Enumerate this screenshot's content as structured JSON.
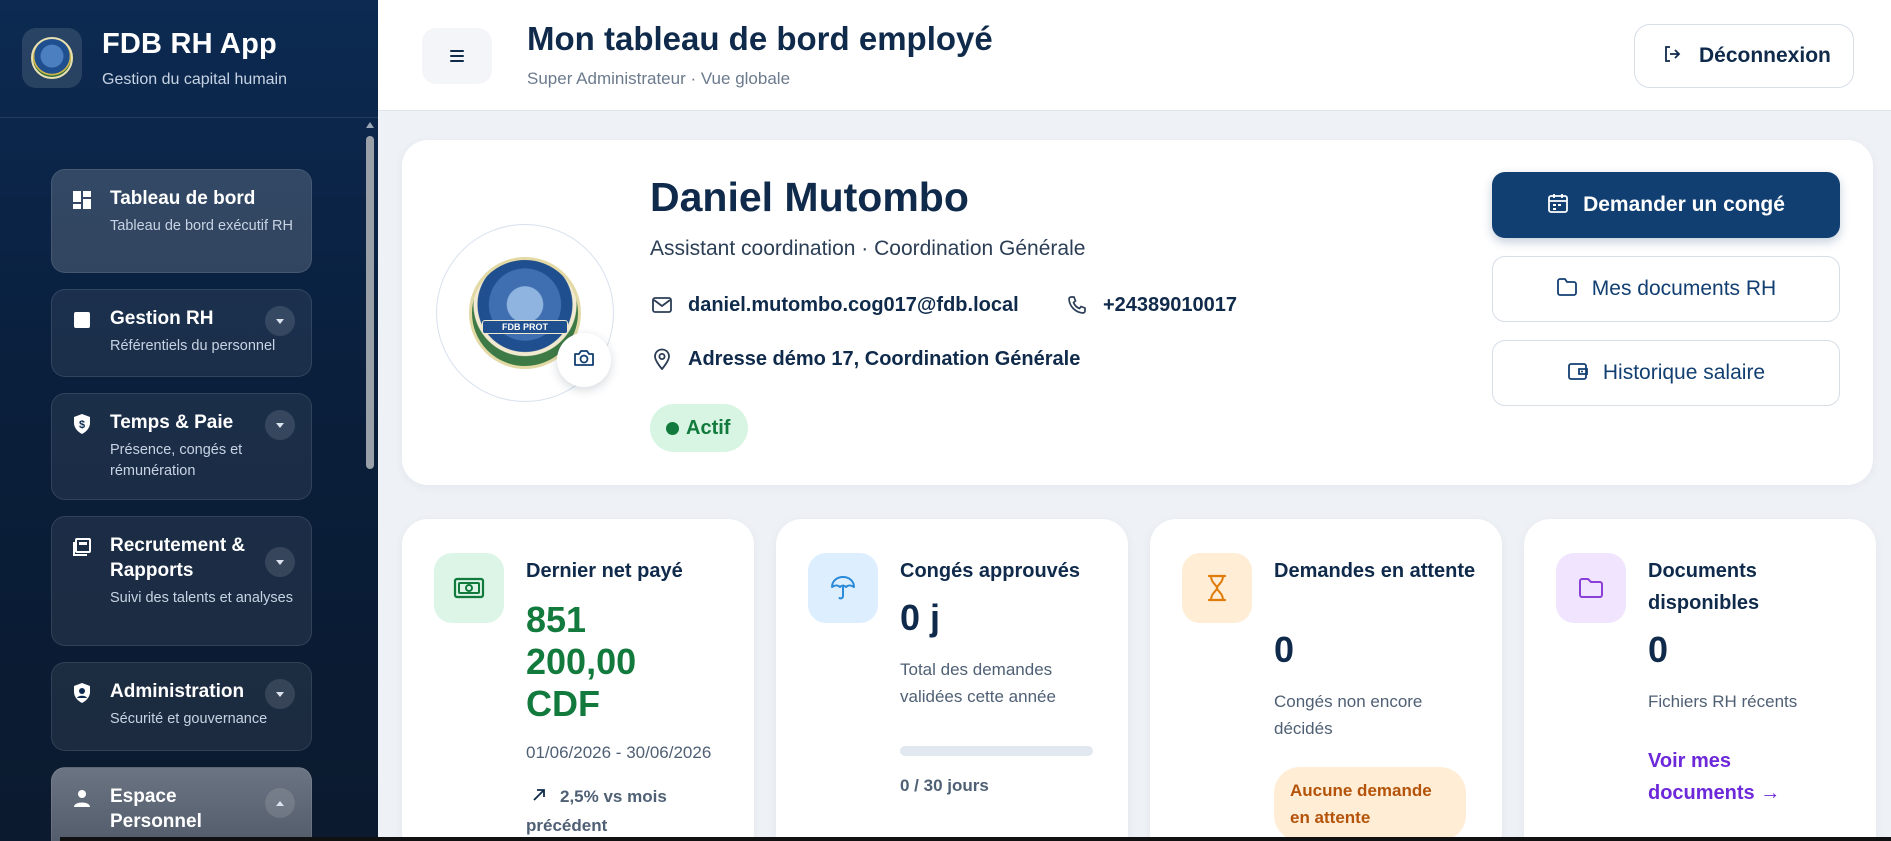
{
  "brand": {
    "title": "FDB RH App",
    "subtitle": "Gestion du capital humain"
  },
  "sidebar": {
    "items": [
      {
        "title": "Tableau de bord",
        "desc": "Tableau de bord exécutif RH"
      },
      {
        "title": "Gestion RH",
        "desc": "Référentiels du personnel"
      },
      {
        "title": "Temps & Paie",
        "desc": "Présence, congés et rémunération"
      },
      {
        "title": "Recrutement & Rapports",
        "desc": "Suivi des talents et analyses"
      },
      {
        "title": "Administration",
        "desc": "Sécurité et gouvernance"
      },
      {
        "title": "Espace Personnel",
        "desc": ""
      }
    ]
  },
  "header": {
    "title": "Mon tableau de bord employé",
    "subtitle": "Super Administrateur · Vue globale",
    "logout_label": "Déconnexion"
  },
  "profile": {
    "avatar_text": "FDB PROT",
    "name": "Daniel Mutombo",
    "role": "Assistant coordination · Coordination Générale",
    "email": "daniel.mutombo.cog017@fdb.local",
    "phone": "+24389010017",
    "address": "Adresse démo 17, Coordination Générale",
    "status": "Actif",
    "actions": {
      "leave": "Demander un congé",
      "documents": "Mes documents RH",
      "salary": "Historique salaire"
    }
  },
  "stats": {
    "pay": {
      "title": "Dernier net payé",
      "value": "851 200,00 CDF",
      "period": "01/06/2026 - 30/06/2026",
      "trend": "2,5% vs mois précédent"
    },
    "leave": {
      "title": "Congés approuvés",
      "value": "0 j",
      "desc": "Total des demandes validées cette année",
      "progress_fraction": 0,
      "progress_label": "0 / 30 jours"
    },
    "pending": {
      "title": "Demandes en attente",
      "value": "0",
      "desc": "Congés non encore décidés",
      "pill": "Aucune demande en attente"
    },
    "docs": {
      "title": "Documents disponibles",
      "value": "0",
      "desc": "Fichiers RH récents",
      "link": "Voir mes documents →"
    }
  },
  "colors": {
    "primary": "#123f72",
    "success": "#127a3c",
    "warning": "#b45309",
    "link": "#6d28d9"
  }
}
